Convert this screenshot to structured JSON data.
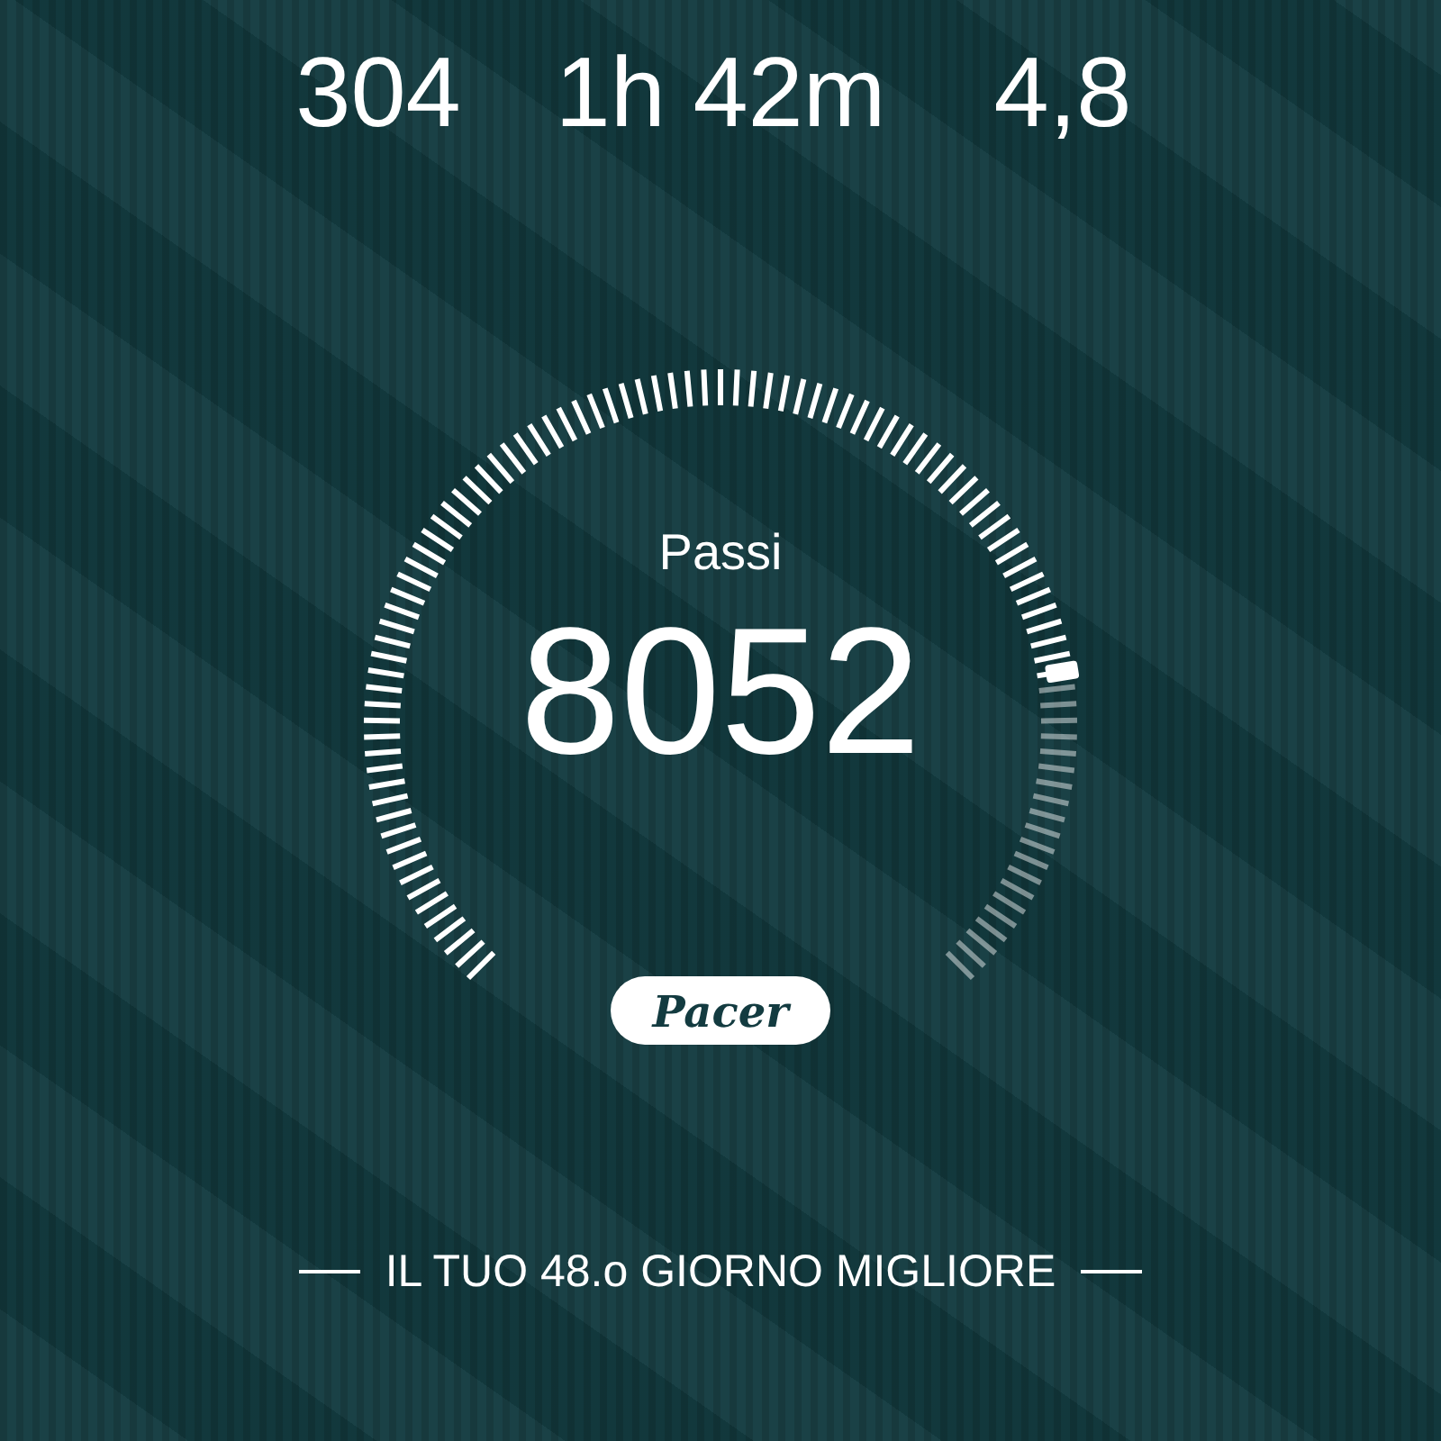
{
  "stats": [
    {
      "value": "304"
    },
    {
      "value": "1h 42m"
    },
    {
      "value": "4,8"
    }
  ],
  "gauge": {
    "label": "Passi",
    "value": "8052"
  },
  "logo": {
    "text": "Pacer"
  },
  "footer": {
    "text": "IL TUO 48.o GIORNO MIGLIORE"
  }
}
